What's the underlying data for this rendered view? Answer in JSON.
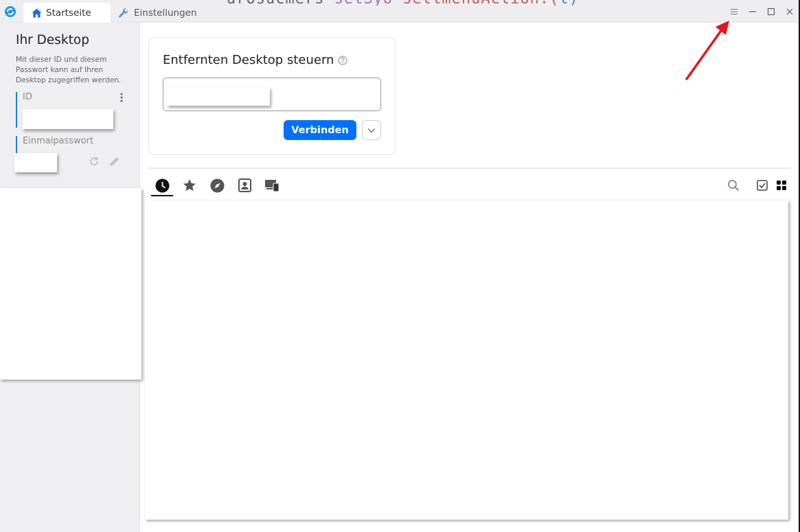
{
  "titlebar": {
    "tabs": [
      {
        "label": "Startseite",
        "icon": "home-icon",
        "active": true
      },
      {
        "label": "Einstellungen",
        "icon": "wrench-icon",
        "active": false
      }
    ],
    "window_controls": [
      "menu-icon",
      "minimize-icon",
      "maximize-icon",
      "close-icon"
    ],
    "background_code": {
      "t1": "drosucmers ",
      "t2": "setSyo ",
      "t3": "setlmenuAction.(",
      "t4": "t) "
    }
  },
  "sidebar": {
    "title": "Ihr Desktop",
    "description": "Mit dieser ID und diesem Passwort kann auf Ihren Desktop zugegriffen werden.",
    "id_label": "ID",
    "otp_label": "Einmalpasswort"
  },
  "connect_card": {
    "title": "Entfernten Desktop steuern",
    "connect_label": "Verbinden"
  },
  "peer_tabs": [
    "recent-icon",
    "favorites-icon",
    "discovered-icon",
    "address-book-icon",
    "group-icon"
  ],
  "colors": {
    "accent": "#0071ff",
    "sidebar_bg": "#efeff1",
    "annotation_arrow": "#e8141a"
  }
}
